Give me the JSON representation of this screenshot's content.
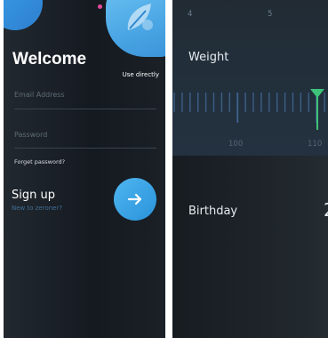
{
  "login": {
    "title": "Welcome",
    "use_directly": "Use directly",
    "email_label": "Email Address",
    "password_label": "Password",
    "forgot_password": "Forget password?",
    "signup_title": "Sign up",
    "signup_subtitle": "New to zeroner?",
    "accent_color": "#3aa3e6"
  },
  "profile": {
    "top_ruler_numbers": [
      "4",
      "5"
    ],
    "weight_label": "Weight",
    "weight_ruler_numbers": [
      "100",
      "110"
    ],
    "weight_selected": 110,
    "birthday_label": "Birthday",
    "birthday_value_partial": "2",
    "marker_color": "#3ec27a"
  }
}
